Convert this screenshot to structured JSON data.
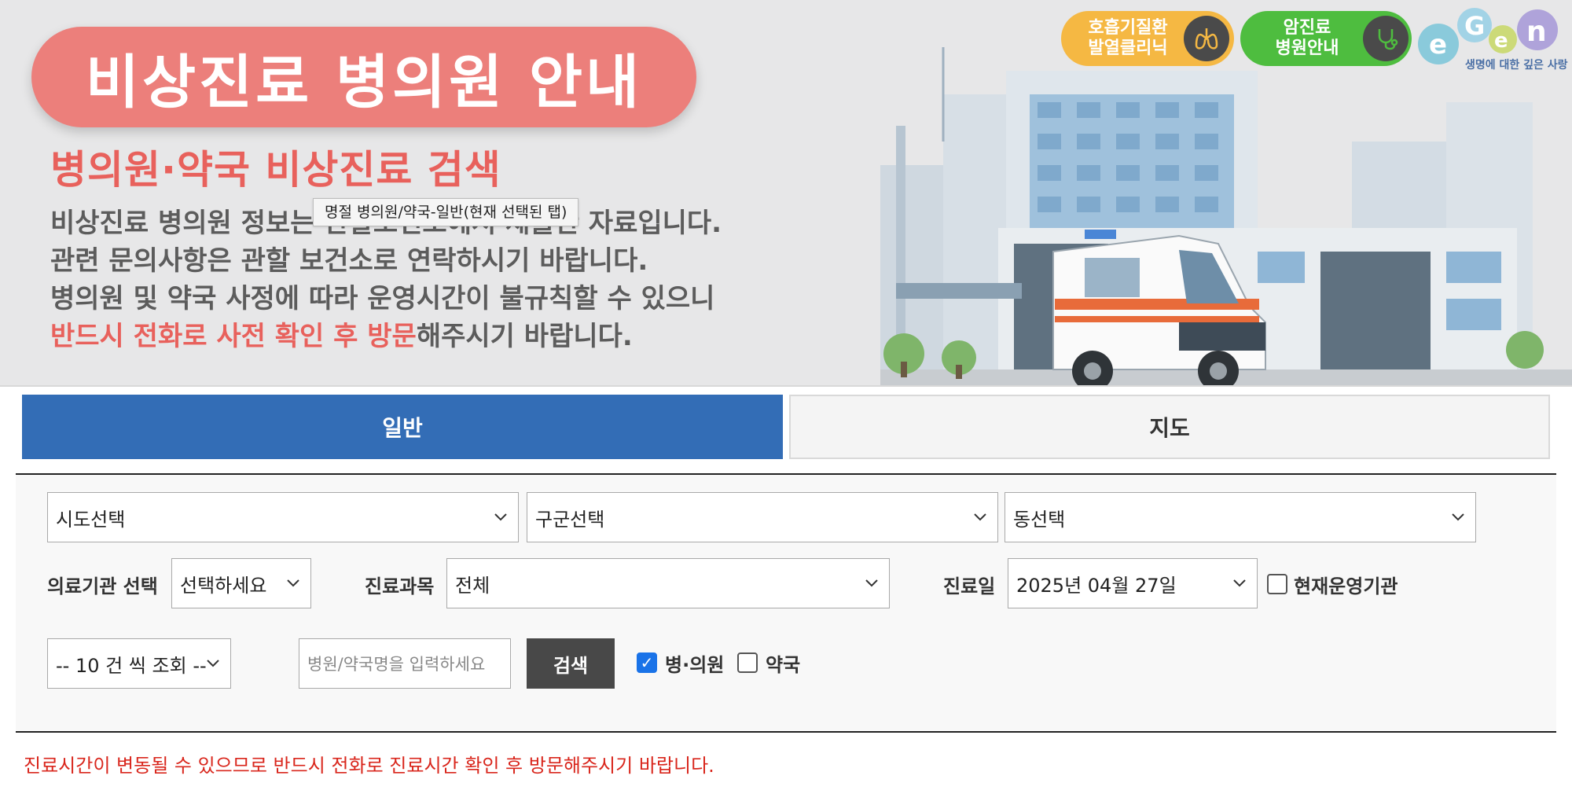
{
  "banner": {
    "title": "비상진료 병의원 안내",
    "subtitle": "병의원·약국 비상진료 검색",
    "info_line1": "비상진료 병의원 정보는 관할보건소에서 제출한 자료입니다.",
    "info_line2": "관련 문의사항은 관할 보건소로 연락하시기 바랍니다.",
    "info_line3": "병의원 및 약국 사정에 따라 운영시간이 불규칙할 수 있으니",
    "info_line4_red": "반드시 전화로 사전 확인 후 방문",
    "info_line4_rest": "해주시기 바랍니다.",
    "tooltip": "명절 병의원/약국-일반(현재 선택된 탭)",
    "badge_respiratory_1": "호흡기질환",
    "badge_respiratory_2": "발열클리닉",
    "badge_cancer_1": "암진료",
    "badge_cancer_2": "병원안내",
    "logo_caption": "생명에 대한 깊은 사랑",
    "respiratory_icon": "lungs-icon",
    "cancer_icon": "stethoscope-icon"
  },
  "tabs": [
    {
      "label": "일반",
      "active": true
    },
    {
      "label": "지도",
      "active": false
    }
  ],
  "search": {
    "sido": "시도선택",
    "gugun": "구군선택",
    "dong": "동선택",
    "org_label": "의료기관 선택",
    "org_value": "선택하세요",
    "dept_label": "진료과목",
    "dept_value": "전체",
    "date_label": "진료일",
    "date_value": "2025년 04월 27일",
    "operating_label": "현재운영기관",
    "operating_checked": false,
    "page_size": "-- 10 건 씩 조회 --",
    "name_placeholder": "병원/약국명을 입력하세요",
    "search_button": "검색",
    "hospital_label": "병·의원",
    "hospital_checked": true,
    "pharmacy_label": "약국",
    "pharmacy_checked": false
  },
  "notice": "진료시간이 변동될 수 있으므로 반드시 전화로 진료시간 확인 후 방문해주시기 바랍니다.",
  "colors": {
    "title_pill": "#ec7f7b",
    "accent_red": "#e8615c",
    "tab_active": "#336db6",
    "notice_red": "#d9261c"
  }
}
